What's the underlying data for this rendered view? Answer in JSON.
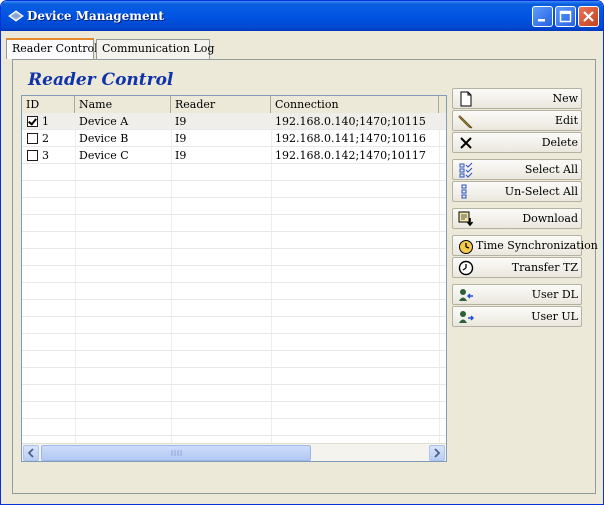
{
  "window": {
    "title": "Device Management"
  },
  "tabs": [
    {
      "label": "Reader Control",
      "active": true
    },
    {
      "label": "Communication Log",
      "active": false
    }
  ],
  "panel": {
    "title": "Reader Control"
  },
  "grid": {
    "columns": [
      "ID",
      "Name",
      "Reader",
      "Connection"
    ],
    "rows": [
      {
        "checked": true,
        "id": "1",
        "name": "Device A",
        "reader": "I9",
        "connection": "192.168.0.140;1470;10115"
      },
      {
        "checked": false,
        "id": "2",
        "name": "Device B",
        "reader": "I9",
        "connection": "192.168.0.141;1470;10116"
      },
      {
        "checked": false,
        "id": "3",
        "name": "Device C",
        "reader": "I9",
        "connection": "192.168.0.142;1470;10117"
      }
    ]
  },
  "buttons": {
    "new": {
      "label": "New",
      "icon": "new-document-icon"
    },
    "edit": {
      "label": "Edit",
      "icon": "pencil-icon"
    },
    "delete": {
      "label": "Delete",
      "icon": "delete-x-icon"
    },
    "select_all": {
      "label": "Select All",
      "icon": "select-all-icon"
    },
    "unselect_all": {
      "label": "Un-Select All",
      "icon": "unselect-all-icon"
    },
    "download": {
      "label": "Download",
      "icon": "download-icon"
    },
    "time_sync": {
      "label": "Time Synchronization",
      "icon": "clock-icon"
    },
    "transfer_tz": {
      "label": "Transfer TZ",
      "icon": "timer-icon"
    },
    "user_dl": {
      "label": "User DL",
      "icon": "user-download-icon"
    },
    "user_ul": {
      "label": "User UL",
      "icon": "user-upload-icon"
    }
  },
  "colors": {
    "titlebar": "#0054e3",
    "panel_title": "#1133aa",
    "active_tab_accent": "#e68b2c"
  }
}
